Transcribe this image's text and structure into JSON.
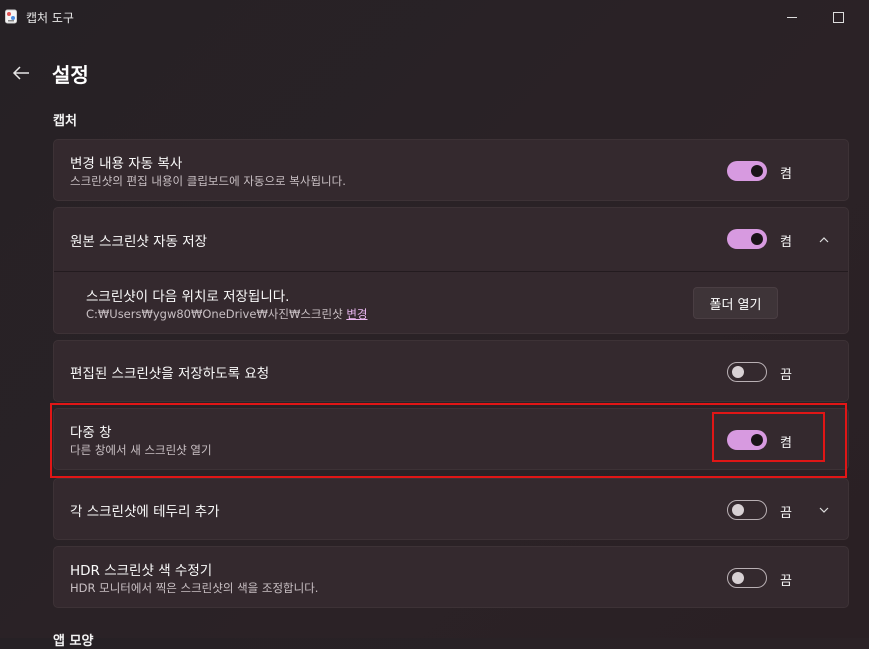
{
  "window": {
    "title": "캡처 도구"
  },
  "page": {
    "title": "설정",
    "back_icon": "arrow-left-icon"
  },
  "sections": [
    {
      "header": "캡처"
    },
    {
      "header": "앱 모양"
    }
  ],
  "settings": {
    "auto_copy": {
      "title": "변경 내용 자동 복사",
      "subtitle": "스크린샷의 편집 내용이 클립보드에 자동으로 복사됩니다.",
      "state": "켬",
      "on": true
    },
    "auto_save": {
      "title": "원본 스크린샷 자동 저장",
      "state": "켬",
      "on": true,
      "expanded": true
    },
    "save_location": {
      "title": "스크린샷이 다음 위치로 저장됩니다.",
      "path": "C:₩Users₩ygw80₩OneDrive₩사진₩스크린샷",
      "change_label": "변경",
      "button_label": "폴더 열기"
    },
    "prompt_save": {
      "title": "편집된 스크린샷을 저장하도록 요청",
      "state": "끔",
      "on": false
    },
    "multi_window": {
      "title": "다중 창",
      "subtitle": "다른 창에서 새 스크린샷 열기",
      "state": "켬",
      "on": true
    },
    "border": {
      "title": "각 스크린샷에 테두리 추가",
      "state": "끔",
      "on": false,
      "expanded": false
    },
    "hdr": {
      "title": "HDR 스크린샷 색 수정기",
      "subtitle": "HDR 모니터에서 찍은 스크린샷의 색을 조정합니다.",
      "state": "끔",
      "on": false
    }
  },
  "colors": {
    "accent": "#d79ae0",
    "highlight": "#e01616"
  }
}
